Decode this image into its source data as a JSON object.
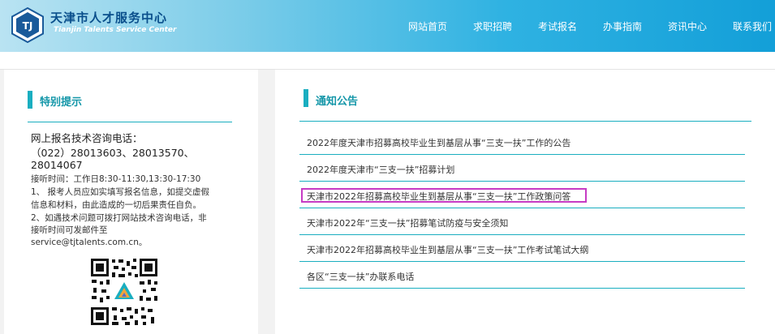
{
  "header": {
    "title": "天津市人才服务中心",
    "subtitle": "Tianjin Talents Service Center",
    "logo_text": "TJ"
  },
  "nav": [
    {
      "label": "网站首页"
    },
    {
      "label": "求职招聘"
    },
    {
      "label": "考试报名"
    },
    {
      "label": "办事指南"
    },
    {
      "label": "资讯中心"
    },
    {
      "label": "联系我们"
    }
  ],
  "left_panel": {
    "title": "特别提示",
    "phone_heading": "网上报名技术咨询电话：",
    "phone_line1": "（022）28013603、28013570、",
    "phone_line2": "28014067",
    "hours": "接听时间：工作日8:30-11:30,13:30-17:30",
    "note1_line1": "1、 报考人员应如实填写报名信息，如提交虚假",
    "note1_line2": "信息和材料，由此造成的一切后果责任自负。",
    "note2_line1": "2、如遇技术问题可拨打网站技术咨询电话，非",
    "note2_line2": "接听时间可发邮件至",
    "email": "service@tjtalents.com.cn。"
  },
  "right_panel": {
    "title": "通知公告",
    "notices": [
      "2022年度天津市招募高校毕业生到基层从事“三支一扶”工作的公告",
      "2022年度天津市“三支一扶”招募计划",
      "天津市2022年招募高校毕业生到基层从事“三支一扶”工作政策问答",
      "天津市2022年“三支一扶”招募笔试防疫与安全须知",
      "天津市2022年招募高校毕业生到基层从事“三支一扶”工作考试笔试大纲",
      "各区“三支一扶”办联系电话"
    ]
  },
  "colors": {
    "accent": "#1aaec0",
    "highlight": "#c63bc4",
    "title_blue": "#0a4f8c"
  },
  "icons": {
    "logo": "tianjin-talents-logo-icon",
    "qr": "qr-code-icon"
  }
}
